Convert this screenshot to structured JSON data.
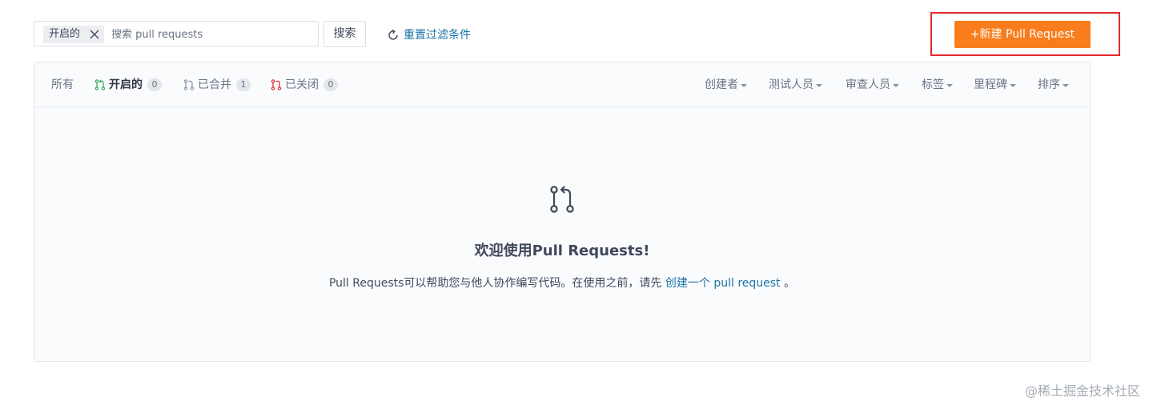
{
  "toolbar": {
    "active_filter": "开启的",
    "search_placeholder": "搜索 pull requests",
    "search_button": "搜索",
    "reset_label": "重置过滤条件",
    "new_pr_label": "+新建 Pull Request"
  },
  "tabs": [
    {
      "label": "所有",
      "count": null
    },
    {
      "label": "开启的",
      "count": "0",
      "icon": "pull-request-open-icon",
      "color": "#2ea44f"
    },
    {
      "label": "已合并",
      "count": "1",
      "icon": "pull-request-merged-icon",
      "color": "#8c92a4"
    },
    {
      "label": "已关闭",
      "count": "0",
      "icon": "pull-request-closed-icon",
      "color": "#e0292c"
    }
  ],
  "filters": [
    "创建者",
    "测试人员",
    "审查人员",
    "标签",
    "里程碑",
    "排序"
  ],
  "empty_state": {
    "icon": "pull-request-icon",
    "title": "欢迎使用Pull Requests!",
    "desc_prefix": "Pull Requests可以帮助您与他人协作编写代码。在使用之前，请先",
    "desc_link": "创建一个 pull request",
    "desc_suffix": "。"
  },
  "watermark": "@稀土掘金技术社区",
  "colors": {
    "accent_orange": "#f97d1c",
    "link_blue": "#1c73a7",
    "highlight_red": "#e0292c"
  }
}
